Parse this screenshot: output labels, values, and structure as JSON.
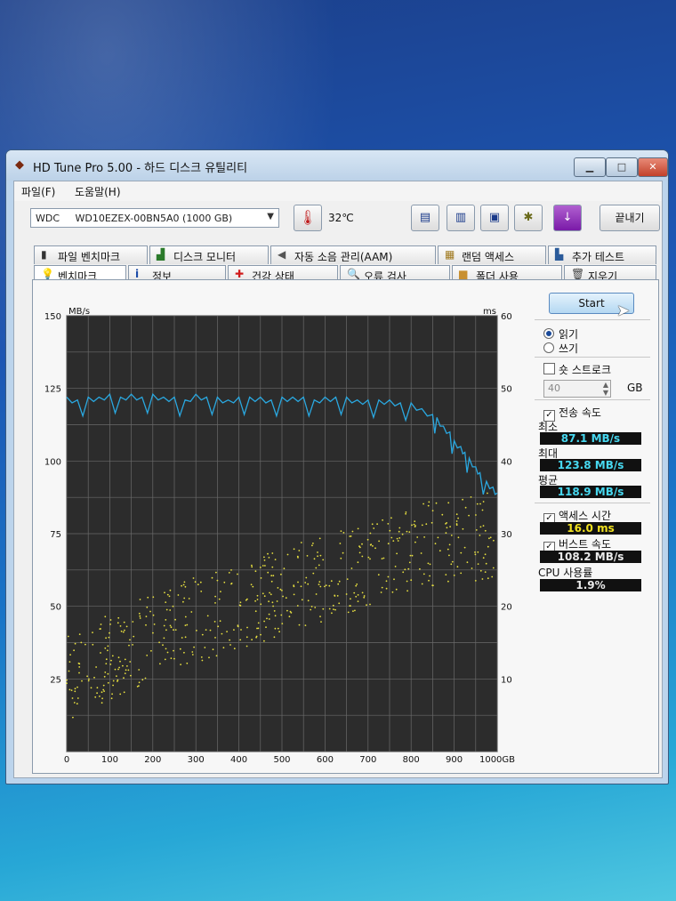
{
  "window": {
    "title": "HD Tune Pro 5.00 - 하드 디스크 유틸리티"
  },
  "menu": {
    "file": "파일(F)",
    "help": "도움말(H)"
  },
  "toolbar": {
    "drive_vendor": "WDC",
    "drive_model": "WD10EZEX-00BN5A0 (1000 GB)",
    "temperature": "32℃",
    "exit_label": "끝내기"
  },
  "tabs_top": [
    {
      "label": "파일 벤치마크",
      "icon": "file-benchmark-icon"
    },
    {
      "label": "디스크 모니터",
      "icon": "disk-monitor-icon"
    },
    {
      "label": "자동 소음 관리(AAM)",
      "icon": "speaker-icon"
    },
    {
      "label": "랜덤 액세스",
      "icon": "random-access-icon"
    },
    {
      "label": "추가 테스트",
      "icon": "extra-tests-icon"
    }
  ],
  "tabs_bottom": [
    {
      "label": "벤치마크",
      "icon": "lightbulb-icon",
      "active": true
    },
    {
      "label": "정보",
      "icon": "info-icon"
    },
    {
      "label": "건강 상태",
      "icon": "health-cross-icon"
    },
    {
      "label": "오류 검사",
      "icon": "magnifier-icon"
    },
    {
      "label": "폴더 사용",
      "icon": "folder-icon"
    },
    {
      "label": "지우기",
      "icon": "trash-icon"
    }
  ],
  "side": {
    "start_label": "Start",
    "read_label": "읽기",
    "write_label": "쓰기",
    "short_stroke_label": "숏 스트로크",
    "short_stroke_value": "40",
    "short_stroke_unit": "GB",
    "transfer_rate_label": "전송 속도",
    "min_label": "최소",
    "min_value": "87.1 MB/s",
    "max_label": "최대",
    "max_value": "123.8 MB/s",
    "avg_label": "평균",
    "avg_value": "118.9 MB/s",
    "access_time_label": "액세스 시간",
    "access_time_value": "16.0 ms",
    "burst_rate_label": "버스트 속도",
    "burst_rate_value": "108.2 MB/s",
    "cpu_label": "CPU 사용률",
    "cpu_value": "1.9%"
  },
  "colors": {
    "transfer_line": "#2aa8e0",
    "access_points": "#e8e040",
    "plot_bg": "#2c2c2c",
    "grid": "#6a6a6a"
  },
  "chart_data": {
    "type": "line",
    "y_left_unit": "MB/s",
    "y_right_unit": "ms",
    "y_left_ticks": [
      "150",
      "125",
      "100",
      "75",
      "50",
      "25"
    ],
    "y_right_ticks": [
      "60",
      "50",
      "40",
      "30",
      "20",
      "10"
    ],
    "x_ticks": [
      "0",
      "100",
      "200",
      "300",
      "400",
      "500",
      "600",
      "700",
      "800",
      "900",
      "1000GB"
    ],
    "xlim": [
      0,
      1000
    ],
    "ylim_left": [
      0,
      150
    ],
    "ylim_right": [
      0,
      60
    ],
    "grid": true,
    "series": [
      {
        "axis": "left",
        "x": [
          0,
          25,
          50,
          75,
          100,
          125,
          150,
          175,
          200,
          225,
          250,
          275,
          300,
          325,
          350,
          375,
          400,
          425,
          450,
          475,
          500,
          525,
          550,
          575,
          600,
          625,
          650,
          675,
          700,
          725,
          750,
          775,
          800,
          825,
          850,
          860,
          875,
          890,
          900,
          915,
          925,
          935,
          950,
          960,
          975,
          990,
          1000
        ],
        "values": [
          122,
          121,
          122,
          122,
          123,
          122,
          123,
          122,
          123,
          122,
          122,
          121,
          123,
          122,
          122,
          121,
          122,
          122,
          122,
          121,
          122,
          122,
          122,
          121,
          122,
          122,
          122,
          121,
          121,
          121,
          121,
          120,
          120,
          118,
          116,
          115,
          112,
          110,
          107,
          105,
          103,
          101,
          98,
          96,
          93,
          91,
          89
        ]
      },
      {
        "axis": "right",
        "kind": "scatter",
        "trend_x": [
          0,
          100,
          200,
          300,
          400,
          500,
          600,
          700,
          800,
          900,
          1000
        ],
        "trend_y": [
          10,
          13,
          16,
          18,
          20,
          22,
          24,
          26,
          28,
          29,
          30
        ]
      }
    ]
  }
}
